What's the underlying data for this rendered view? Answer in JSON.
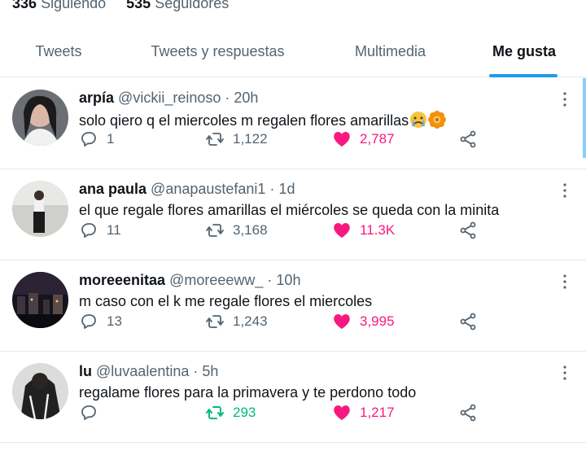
{
  "profile": {
    "following_count": "336",
    "following_label": "Siguiendo",
    "followers_count": "535",
    "followers_label": "Seguidores"
  },
  "tabs": [
    {
      "label": "Tweets",
      "active": false
    },
    {
      "label": "Tweets y respuestas",
      "active": false
    },
    {
      "label": "Multimedia",
      "active": false
    },
    {
      "label": "Me gusta",
      "active": true
    }
  ],
  "colors": {
    "accent": "#1d9bf0",
    "like": "#f91880",
    "retweet": "#00ba7c",
    "muted": "#536471"
  },
  "tweets": [
    {
      "name": "arpía",
      "handle": "@vickii_reinoso",
      "time": "20h",
      "text": "solo qiero q el miercoles m regalen flores amarillas",
      "emojis": [
        "crying-face-emoji",
        "flower-emoji"
      ],
      "replies": "1",
      "retweets": "1,122",
      "likes": "2,787",
      "retweeted": false,
      "liked": true
    },
    {
      "name": "ana paula",
      "handle": "@anapaustefani1",
      "time": "1d",
      "text": "el que regale flores amarillas el miércoles se queda con la minita",
      "emojis": [],
      "replies": "11",
      "retweets": "3,168",
      "likes": "11.3K",
      "retweeted": false,
      "liked": true
    },
    {
      "name": "moreeenitaa",
      "handle": "@moreeeww_",
      "time": "10h",
      "text": "m caso con el k me regale flores el miercoles",
      "emojis": [],
      "replies": "13",
      "retweets": "1,243",
      "likes": "3,995",
      "retweeted": false,
      "liked": true
    },
    {
      "name": "lu",
      "handle": "@luvaalentina",
      "time": "5h",
      "text": "regalame flores para la primavera y te perdono todo",
      "emojis": [],
      "replies": "",
      "retweets": "293",
      "likes": "1,217",
      "retweeted": true,
      "liked": true
    }
  ],
  "separator": "·",
  "icons": [
    "reply-icon",
    "retweet-icon",
    "heart-icon",
    "share-icon",
    "more-options-icon"
  ]
}
